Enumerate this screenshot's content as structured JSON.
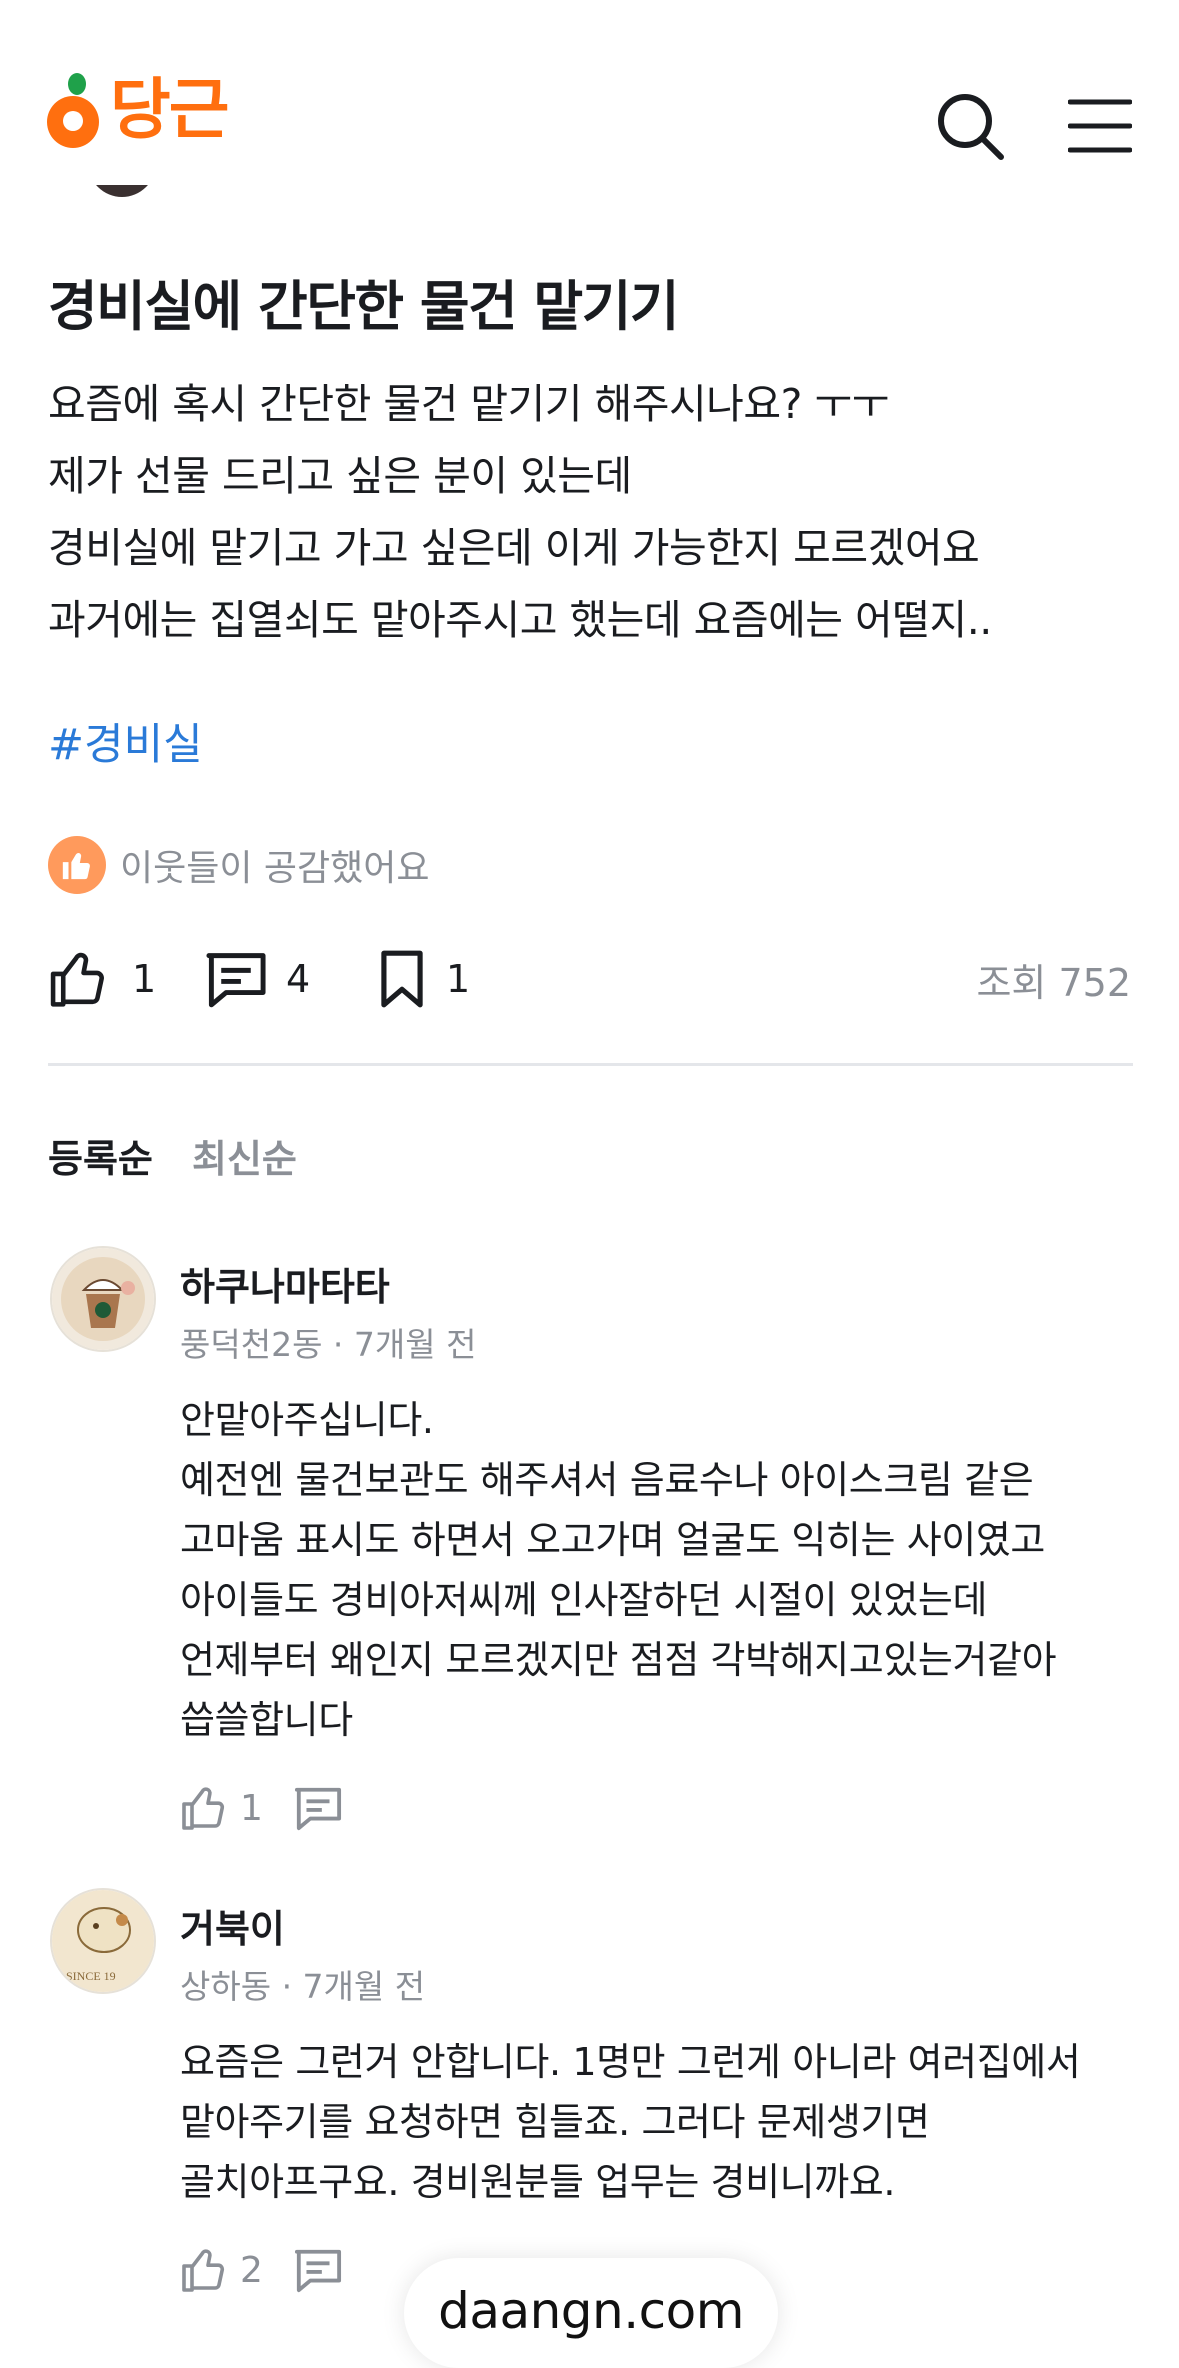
{
  "header": {
    "logo_text": "당근"
  },
  "post": {
    "title": "경비실에 간단한 물건 맡기기",
    "body": [
      "요즘에 혹시 간단한 물건 맡기기 해주시나요? ㅜㅜ",
      "제가 선물 드리고 싶은 분이 있는데",
      "경비실에 맡기고 가고 싶은데 이게 가능한지 모르겠어요",
      "과거에는 집열쇠도 맡아주시고 했는데 요즘에는 어떨지.."
    ],
    "hashtag": "#경비실",
    "empathy_text": "이웃들이 공감했어요",
    "likes": "1",
    "comments": "4",
    "bookmarks": "1",
    "views": "조회 752"
  },
  "sort": {
    "registered": "등록순",
    "latest": "최신순"
  },
  "comments": [
    {
      "name": "하쿠나마타타",
      "meta": "풍덕천2동 · 7개월 전",
      "lines": [
        "안맡아주십니다.",
        "예전엔 물건보관도 해주셔서 음료수나 아이스크림 같은",
        "고마움 표시도 하면서 오고가며 얼굴도 익히는 사이였고",
        "아이들도 경비아저씨께 인사잘하던 시절이 있었는데",
        "언제부터 왜인지 모르겠지만 점점 각박해지고있는거같아",
        "씁쓸합니다"
      ],
      "likes": "1"
    },
    {
      "name": "거북이",
      "meta": "상하동 · 7개월 전",
      "avatar_text": "SINCE 19",
      "lines": [
        "요즘은 그런거 안합니다. 1명만 그런게 아니라 여러집에서",
        "맡아주기를 요청하면 힘들죠. 그러다 문제생기면",
        "골치아프구요. 경비원분들 업무는 경비니까요."
      ],
      "likes": "2"
    }
  ],
  "footer": {
    "domain": "daangn.com"
  },
  "colors": {
    "brand": "#ff6f0f",
    "hashtag": "#2a7ad8",
    "muted": "#8b8f96"
  }
}
